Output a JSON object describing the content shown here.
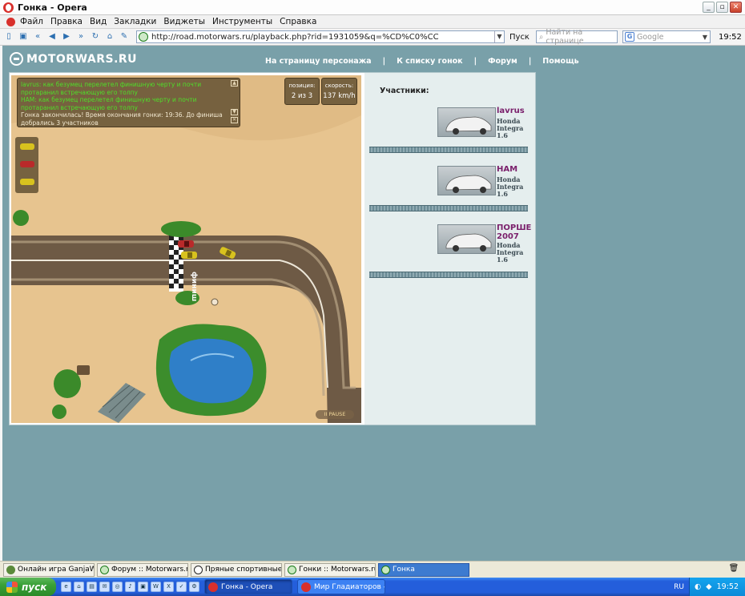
{
  "window": {
    "title": "Гонка - Opera"
  },
  "menu": [
    "Файл",
    "Правка",
    "Вид",
    "Закладки",
    "Виджеты",
    "Инструменты",
    "Справка"
  ],
  "toolbar": {
    "address": "http://road.motorwars.ru/playback.php?rid=1931059&q=%CD%C0%CC",
    "go_label": "Пуск",
    "find_placeholder": "Найти на странице",
    "search_placeholder": "Google",
    "time": "19:52"
  },
  "site": {
    "logo": "MOTORWARS.RU",
    "nav": [
      "На страницу персонажа",
      "К списку гонок",
      "Форум",
      "Помощь"
    ]
  },
  "game": {
    "chat": [
      {
        "text": "lavrus: как безумец перелетел финишную черту и почти протаранил встречающую его толпу",
        "color": "green"
      },
      {
        "text": "НАМ: как безумец перелетел финишную черту и почти протаранил встречающую его толпу",
        "color": "green"
      },
      {
        "text": "Гонка закончилась! Время окончания гонки: 19:36. До финиша добрались 3 участников",
        "color": "white"
      }
    ],
    "position_label": "позиция:",
    "position_value": "2 из 3",
    "speed_label": "скорость:",
    "speed_value": "137 km/h",
    "finish_text": "финиш",
    "pause_label": "II PAUSE"
  },
  "participants": {
    "title": "Участники:",
    "items": [
      {
        "name": "lavrus",
        "car": [
          "Honda",
          "Integra",
          "1.6"
        ]
      },
      {
        "name": "НАМ",
        "car": [
          "Honda",
          "Integra",
          "1.6"
        ]
      },
      {
        "name": "ПОРШЕ 2007",
        "car": [
          "Honda",
          "Integra",
          "1.6"
        ]
      }
    ]
  },
  "browser_tabs": [
    "Онлайн игра GanjaWars...",
    "Форум :: Motorwars.ru",
    "Пряные спортивные тр...",
    "Гонки :: Motorwars.ru",
    "Гонка"
  ],
  "taskbar": {
    "start_label": "пуск",
    "windows": [
      "Гонка - Opera",
      "Мир Гладиаторов - ..."
    ],
    "lang": "RU",
    "time": "19:52"
  },
  "colors": {
    "page_bg": "#79a0a9",
    "sand": "#e7c48f",
    "road": "#7a6650",
    "accent_name": "#7a1f6b"
  }
}
